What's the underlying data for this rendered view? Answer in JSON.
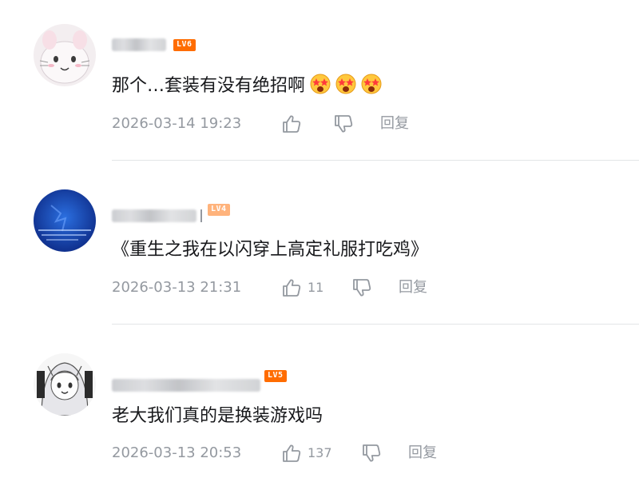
{
  "colors": {
    "text": "#18191c",
    "meta": "#9499a0",
    "divider": "#e3e5e7",
    "lv6": "#ff6c00",
    "lv5": "#ff6c00",
    "lv4": "#ffb37c"
  },
  "comments": [
    {
      "level": "LV6",
      "content": "那个…套装有没有绝招啊",
      "emojis": [
        "star-struck-emoji",
        "star-struck-emoji",
        "star-struck-emoji"
      ],
      "date": "2026-03-14 19:23",
      "likes": "",
      "reply_label": "回复"
    },
    {
      "level": "LV4",
      "content": "《重生之我在以闪穿上高定礼服打吃鸡》",
      "emojis": [],
      "date": "2026-03-13 21:31",
      "likes": "11",
      "reply_label": "回复"
    },
    {
      "level": "LV5",
      "content": "老大我们真的是换装游戏吗",
      "emojis": [],
      "date": "2026-03-13 20:53",
      "likes": "137",
      "reply_label": "回复"
    }
  ],
  "icons": {
    "like": "thumbs-up-icon",
    "dislike": "thumbs-down-icon"
  }
}
